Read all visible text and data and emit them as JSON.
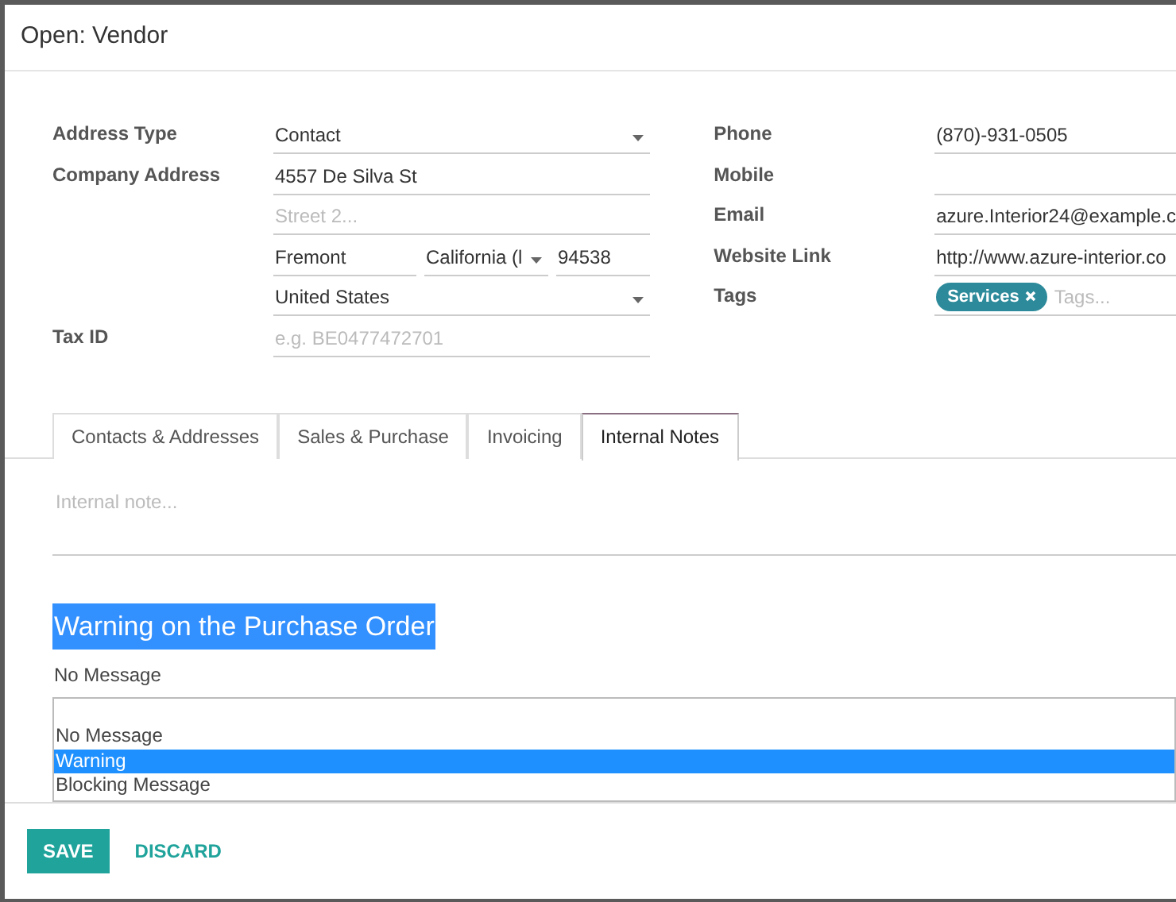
{
  "dialog": {
    "title": "Open: Vendor"
  },
  "left_fields": [
    {
      "label": "Address Type",
      "inputs": [
        {
          "kind": "select",
          "value": "Contact"
        }
      ]
    },
    {
      "label": "Company Address",
      "inputs": [
        {
          "kind": "text",
          "value": "4557 De Silva St"
        }
      ]
    },
    {
      "inputs": [
        {
          "kind": "text",
          "placeholder": "Street 2..."
        }
      ]
    },
    {
      "inputs": [
        {
          "kind": "text",
          "value": "Fremont"
        },
        {
          "kind": "select",
          "value": "California (l"
        },
        {
          "kind": "text",
          "value": "94538"
        }
      ]
    },
    {
      "inputs": [
        {
          "kind": "select",
          "value": "United States"
        }
      ]
    },
    {
      "label": "Tax ID",
      "inputs": [
        {
          "kind": "text",
          "placeholder": "e.g. BE0477472701"
        }
      ]
    }
  ],
  "right_fields": [
    {
      "label": "Phone",
      "inputs": [
        {
          "kind": "text",
          "value": "(870)-931-0505"
        }
      ]
    },
    {
      "label": "Mobile",
      "inputs": [
        {
          "kind": "text"
        }
      ]
    },
    {
      "label": "Email",
      "inputs": [
        {
          "kind": "text",
          "value": "azure.Interior24@example.c"
        }
      ]
    },
    {
      "label": "Website Link",
      "inputs": [
        {
          "kind": "text",
          "value": "http://www.azure-interior.co"
        }
      ]
    },
    {
      "label": "Tags",
      "inputs": [
        {
          "kind": "tags",
          "tags": [
            "Services"
          ],
          "placeholder": "Tags..."
        }
      ]
    }
  ],
  "tabs": [
    {
      "label": "Contacts & Addresses",
      "selected": false
    },
    {
      "label": "Sales & Purchase",
      "selected": false
    },
    {
      "label": "Invoicing",
      "selected": false
    },
    {
      "label": "Internal Notes",
      "selected": true
    }
  ],
  "internal_note": {
    "placeholder": "Internal note..."
  },
  "warning_section": {
    "heading": "Warning on the Purchase Order",
    "heading_highlighted": true,
    "value": "No Message",
    "options": [
      {
        "label": "No Message",
        "highlighted": false
      },
      {
        "label": "Warning",
        "highlighted": true
      },
      {
        "label": "Blocking Message",
        "highlighted": false
      }
    ]
  },
  "buttons": [
    {
      "label": "SAVE",
      "kind": "primary"
    },
    {
      "label": "DISCARD",
      "kind": "link"
    }
  ]
}
